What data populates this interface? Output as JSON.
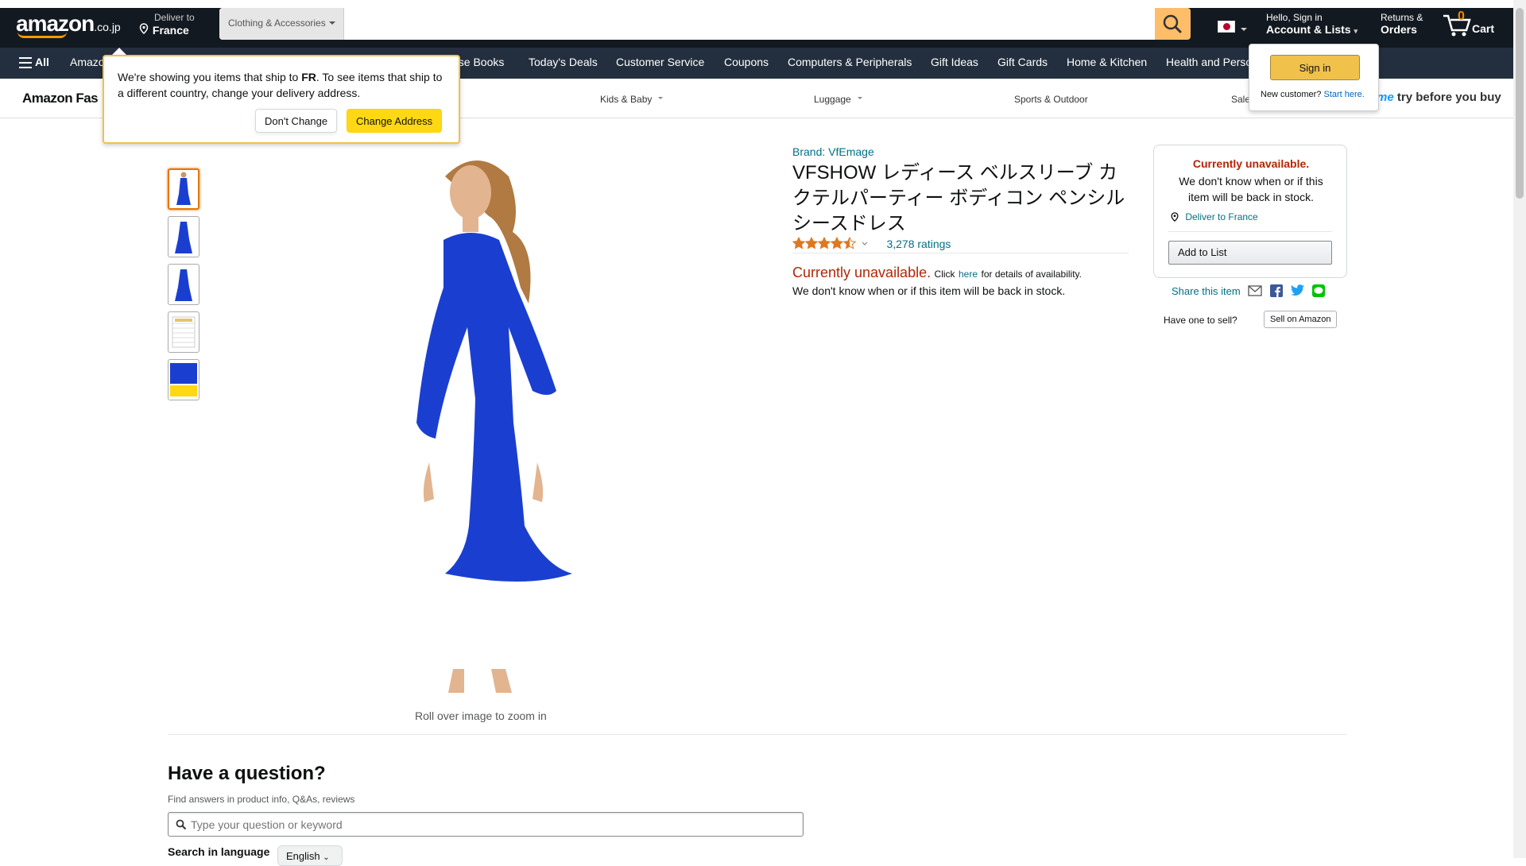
{
  "header": {
    "logo": "amazon",
    "logo_tld": ".co.jp",
    "deliver_line1": "Deliver to",
    "deliver_line2": "France",
    "search_category": "Clothing & Accessories",
    "search_placeholder": "",
    "account_line1": "Hello, Sign in",
    "account_line2": "Account & Lists",
    "returns_line1": "Returns &",
    "returns_line2": "Orders",
    "cart_count": "0",
    "cart_label": "Cart"
  },
  "nav": {
    "all_label": "All",
    "items": [
      "Amazon",
      "ese Books",
      "Today's Deals",
      "Customer Service",
      "Coupons",
      "Computers & Peripherals",
      "Gift Ideas",
      "Gift Cards",
      "Home & Kitchen",
      "Health and Perso"
    ]
  },
  "subnav": {
    "store_title": "Amazon Fas",
    "items": [
      "Kids & Baby",
      "Luggage",
      "Sports & Outdoor",
      "Sale"
    ],
    "promo": "try before you buy",
    "promo_prefix": "me"
  },
  "popover": {
    "text_before": "We're showing you items that ship to ",
    "country": "FR",
    "text_after": ". To see items that ship to a different country, change your delivery address.",
    "dont_change": "Don't Change",
    "change_address": "Change Address"
  },
  "signin_flyout": {
    "button": "Sign in",
    "new_customer": "New customer?",
    "start_here": "Start here."
  },
  "product": {
    "brand": "Brand: VfEmage",
    "title": "VFSHOW レディース ベルスリーブ カクテルパーティー ボディコン ペンシル シースドレス",
    "ratings": "3,278 ratings",
    "stars": 4.5,
    "unavailable": "Currently unavailable.",
    "click": "Click",
    "here": "here",
    "details": "for details of availability.",
    "backstock": "We don't know when or if this item will be back in stock.",
    "zoom_hint": "Roll over image to zoom in",
    "dress_color": "#1a3fd0"
  },
  "buybox": {
    "unavailable": "Currently unavailable.",
    "message": "We don't know when or if this item will be back in stock.",
    "deliver": "Deliver to France",
    "add_to_list": "Add to List",
    "share": "Share this item",
    "have_one": "Have one to sell?",
    "sell": "Sell on Amazon"
  },
  "question": {
    "title": "Have a question?",
    "subtitle": "Find answers in product info, Q&As, reviews",
    "placeholder": "Type your question or keyword",
    "lang_label": "Search in language",
    "lang_value": "English"
  },
  "colors": {
    "header_bg": "#131921",
    "nav_bg": "#232f3e",
    "accent": "#febd69",
    "button_yellow": "#ffd814",
    "link": "#007185",
    "unavailable": "#b12704"
  }
}
